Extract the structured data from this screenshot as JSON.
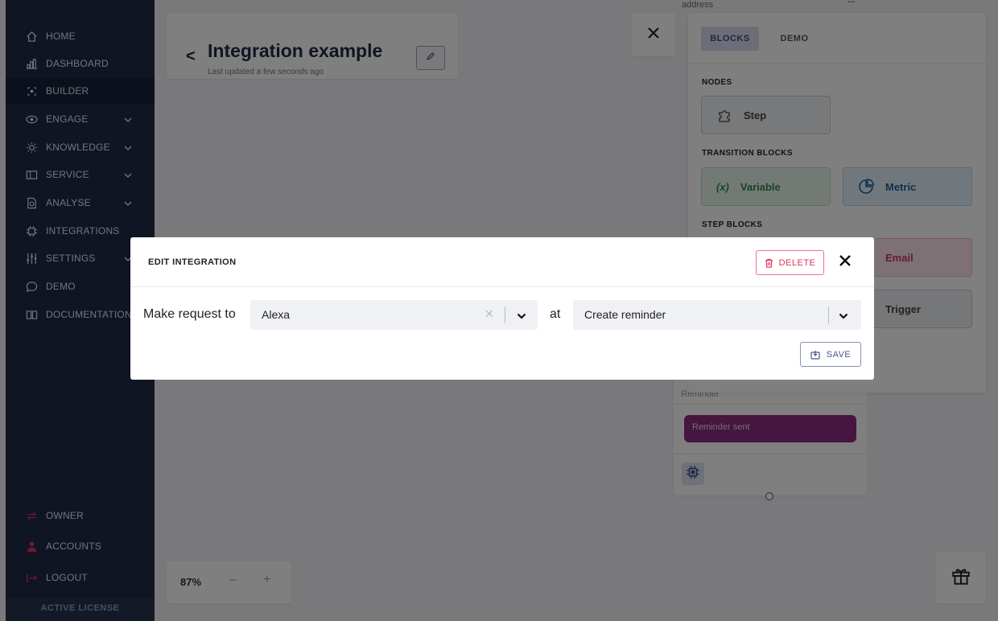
{
  "sidebar": {
    "items": [
      {
        "label": "HOME",
        "icon": "home-icon"
      },
      {
        "label": "DASHBOARD",
        "icon": "dashboard-icon"
      },
      {
        "label": "BUILDER",
        "icon": "builder-icon"
      },
      {
        "label": "ENGAGE",
        "icon": "eye-icon"
      },
      {
        "label": "KNOWLEDGE",
        "icon": "lightbulb-icon"
      },
      {
        "label": "SERVICE",
        "icon": "ticket-icon"
      },
      {
        "label": "ANALYSE",
        "icon": "analyse-icon"
      },
      {
        "label": "INTEGRATIONS",
        "icon": "integrations-icon"
      },
      {
        "label": "SETTINGS",
        "icon": "settings-icon"
      },
      {
        "label": "DEMO",
        "icon": "chat-icon"
      },
      {
        "label": "DOCUMENTATION",
        "icon": "book-icon"
      }
    ],
    "bottom": [
      {
        "label": "OWNER",
        "icon": "swap-icon"
      },
      {
        "label": "ACCOUNTS",
        "icon": "user-icon"
      },
      {
        "label": "LOGOUT",
        "icon": "logout-icon"
      }
    ],
    "license": "ACTIVE LICENSE",
    "colors": {
      "background": "#1f2a44",
      "active": "#17213a",
      "accent": "#e0305a"
    }
  },
  "header": {
    "back": "<",
    "title": "Integration example",
    "subtitle": "Last updated a few seconds ago"
  },
  "zoom": {
    "level": "87%",
    "minus": "–",
    "plus": "+"
  },
  "node": {
    "top_label": "address",
    "top_more": "...",
    "reminder_label": "Reminder",
    "sent_label": "Reminder sent"
  },
  "panel": {
    "tabs": [
      "BLOCKS",
      "DEMO"
    ],
    "sections": {
      "nodes": "NODES",
      "transition": "TRANSITION BLOCKS",
      "step": "STEP BLOCKS"
    },
    "blocks": {
      "step": "Step",
      "variable": "Variable",
      "variable_symbol": "(x)",
      "metric": "Metric",
      "email": "Email",
      "trigger": "Trigger"
    }
  },
  "modal": {
    "title": "EDIT INTEGRATION",
    "delete_label": "DELETE",
    "request_label": "Make request to",
    "service_value": "Alexa",
    "at_label": "at",
    "action_value": "Create reminder",
    "save_label": "SAVE"
  }
}
